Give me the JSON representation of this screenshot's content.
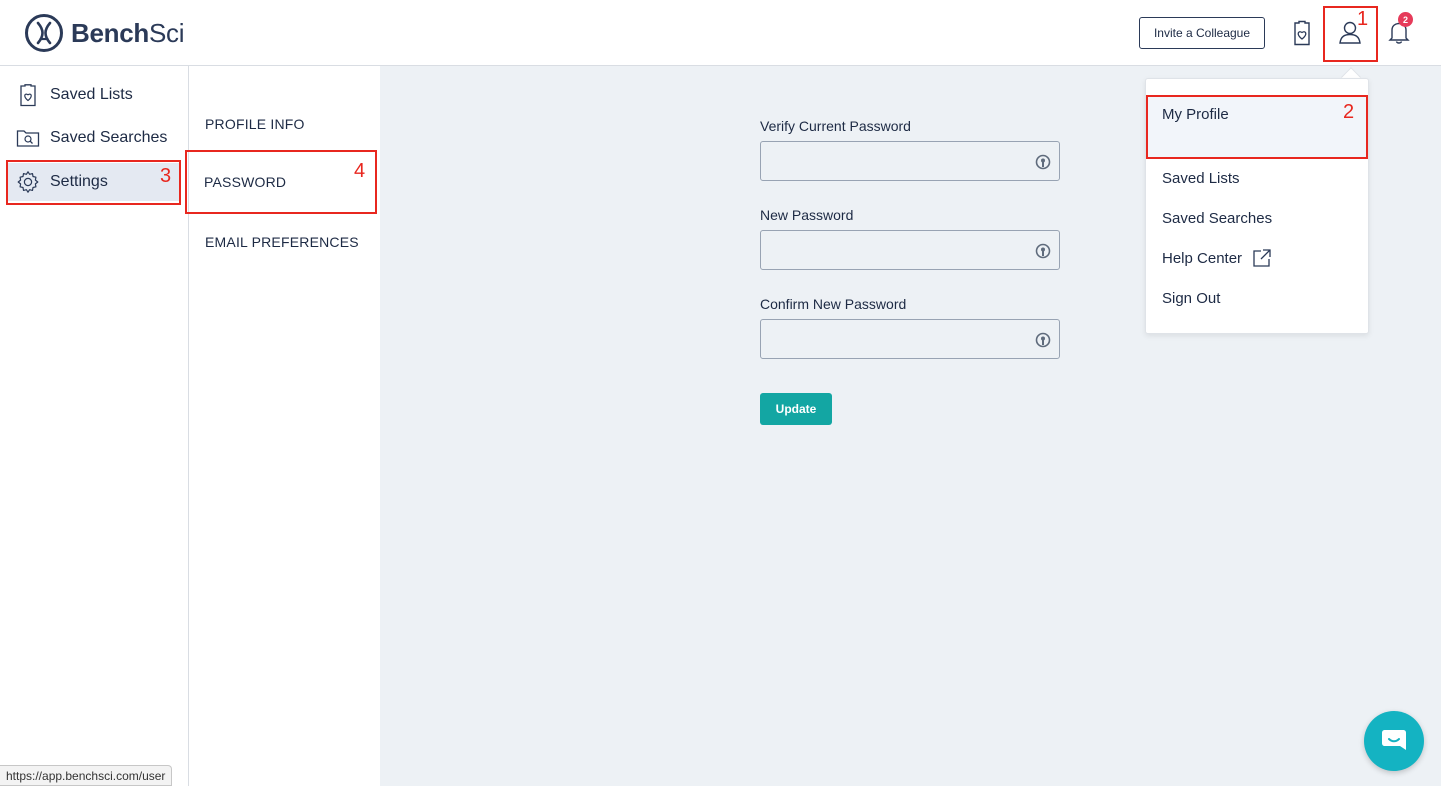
{
  "header": {
    "logo_bold": "Bench",
    "logo_light": "Sci",
    "invite_label": "Invite a Colleague",
    "notification_count": "2",
    "icons": [
      "saved-lists-icon",
      "user-icon",
      "bell-icon"
    ]
  },
  "sidebar": {
    "items": [
      {
        "label": "Saved Lists",
        "icon": "clipboard-heart-icon"
      },
      {
        "label": "Saved Searches",
        "icon": "folder-search-icon"
      },
      {
        "label": "Settings",
        "icon": "gear-icon",
        "active": true
      }
    ]
  },
  "subnav": {
    "items": [
      {
        "label": "PROFILE INFO"
      },
      {
        "label": "PASSWORD",
        "active": true
      },
      {
        "label": "EMAIL PREFERENCES"
      }
    ]
  },
  "form": {
    "current_label": "Verify Current Password",
    "current_value": "",
    "new_label": "New Password",
    "new_value": "",
    "confirm_label": "Confirm New Password",
    "confirm_value": "",
    "update_label": "Update"
  },
  "dropdown": {
    "items": [
      {
        "label": "My Profile"
      },
      {
        "label": "Saved Lists"
      },
      {
        "label": "Saved Searches"
      },
      {
        "label": "Help Center",
        "icon": "external-link-icon"
      },
      {
        "label": "Sign Out"
      }
    ]
  },
  "annotations": [
    "1",
    "2",
    "3",
    "4"
  ],
  "status_bar": {
    "url": "https://app.benchsci.com/user"
  },
  "colors": {
    "primary_text": "#1d2a44",
    "accent_teal": "#13a6a3",
    "chat_teal": "#14b3c2",
    "badge_red": "#e63b5a",
    "annotation_red": "#e8271f",
    "panel_bg": "#edf1f5"
  }
}
